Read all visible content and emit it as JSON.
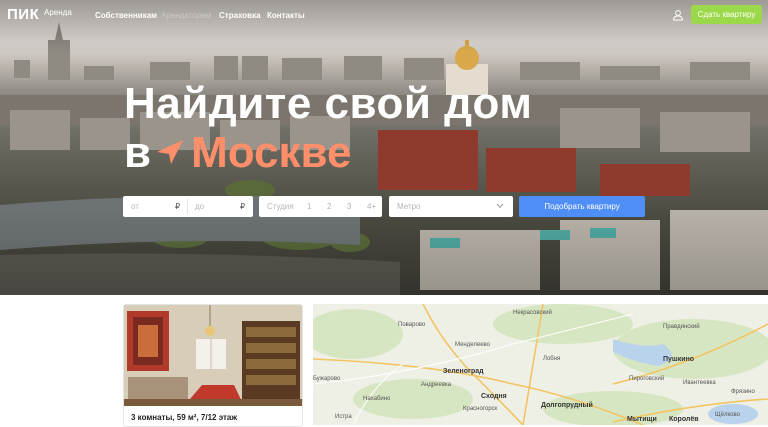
{
  "header": {
    "logo": "ПИК",
    "logo_sub": "Аренда",
    "nav": [
      {
        "label": "Собственникам"
      },
      {
        "label": "Арендаторам"
      },
      {
        "label": "Страховка"
      },
      {
        "label": "Контакты"
      }
    ],
    "cta_label": "Сдать квартиру",
    "icons": {
      "user": "user-icon"
    }
  },
  "hero": {
    "headline_line1": "Найдите свой дом",
    "headline_line2_prefix": "в",
    "headline_line2_city": "Москве",
    "accent_color": "#ff8f6b",
    "search": {
      "price_from_placeholder": "от",
      "price_to_placeholder": "до",
      "currency": "₽",
      "rooms_label": "Студия",
      "rooms_options": [
        "1",
        "2",
        "3",
        "4+"
      ],
      "metro_placeholder": "Метро",
      "submit_label": "Подобрать квартиру",
      "submit_color": "#4f8ef7"
    }
  },
  "listing": {
    "title": "3 комнаты, 59 м², 7/12 этаж"
  },
  "map": {
    "labels": [
      "Некрасовский",
      "Правдинский",
      "Поварово",
      "Менделеево",
      "Пушкино",
      "Лобня",
      "Ивантеевка",
      "Зеленоград",
      "Андреевка",
      "Сходня",
      "Долгопрудный",
      "Мытищи",
      "Королёв",
      "Истра",
      "Фрязино",
      "Щёлково",
      "Пироговский",
      "Красногорск",
      "Нахабино",
      "Бужарово"
    ]
  }
}
